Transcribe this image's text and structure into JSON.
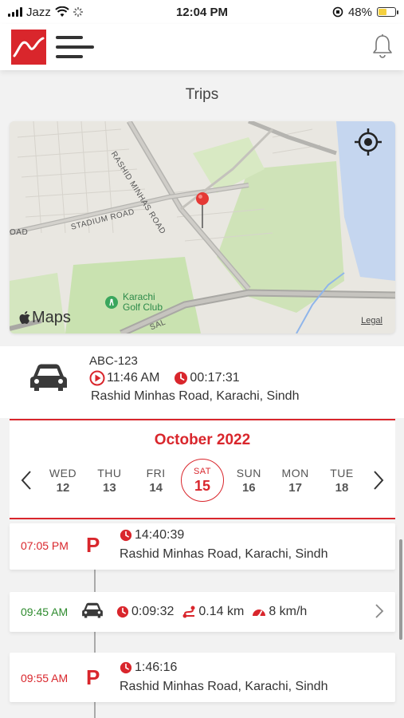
{
  "status_bar": {
    "carrier": "Jazz",
    "time": "12:04 PM",
    "battery": "48%",
    "battery_level": 0.48
  },
  "header": {
    "logo_icon": "stock-chart-logo-icon",
    "menu_icon": "hamburger-menu-icon",
    "notification_icon": "bell-icon"
  },
  "page": {
    "title": "Trips"
  },
  "map": {
    "labels": {
      "road_1": "RASHID MINHAS ROAD",
      "road_2": "STADIUM ROAD",
      "road_3": "OAD",
      "road_4": "SAL",
      "golf_1": "Karachi",
      "golf_2": "Golf Club"
    },
    "brand": "Maps",
    "legal": "Legal"
  },
  "current_trip": {
    "plate": "ABC-123",
    "start_time": "11:46 AM",
    "duration": "00:17:31",
    "address": "Rashid Minhas Road, Karachi, Sindh"
  },
  "calendar": {
    "month": "October 2022",
    "days": [
      {
        "name": "WED",
        "date": "12"
      },
      {
        "name": "THU",
        "date": "13"
      },
      {
        "name": "FRI",
        "date": "14"
      },
      {
        "name": "SAT",
        "date": "15",
        "selected": true
      },
      {
        "name": "SUN",
        "date": "16"
      },
      {
        "name": "MON",
        "date": "17"
      },
      {
        "name": "TUE",
        "date": "18"
      }
    ]
  },
  "timeline": [
    {
      "type": "parking",
      "time": "07:05 PM",
      "duration": "14:40:39",
      "address": "Rashid Minhas Road, Karachi, Sindh"
    },
    {
      "type": "drive",
      "time": "09:45 AM",
      "duration": "0:09:32",
      "distance": "0.14 km",
      "speed": "8 km/h"
    },
    {
      "type": "parking",
      "time": "09:55 AM",
      "duration": "1:46:16",
      "address": "Rashid Minhas Road, Karachi, Sindh"
    }
  ],
  "colors": {
    "accent": "#d9262c",
    "drive_time": "#2e8b2e",
    "park_time": "#d9262c"
  }
}
